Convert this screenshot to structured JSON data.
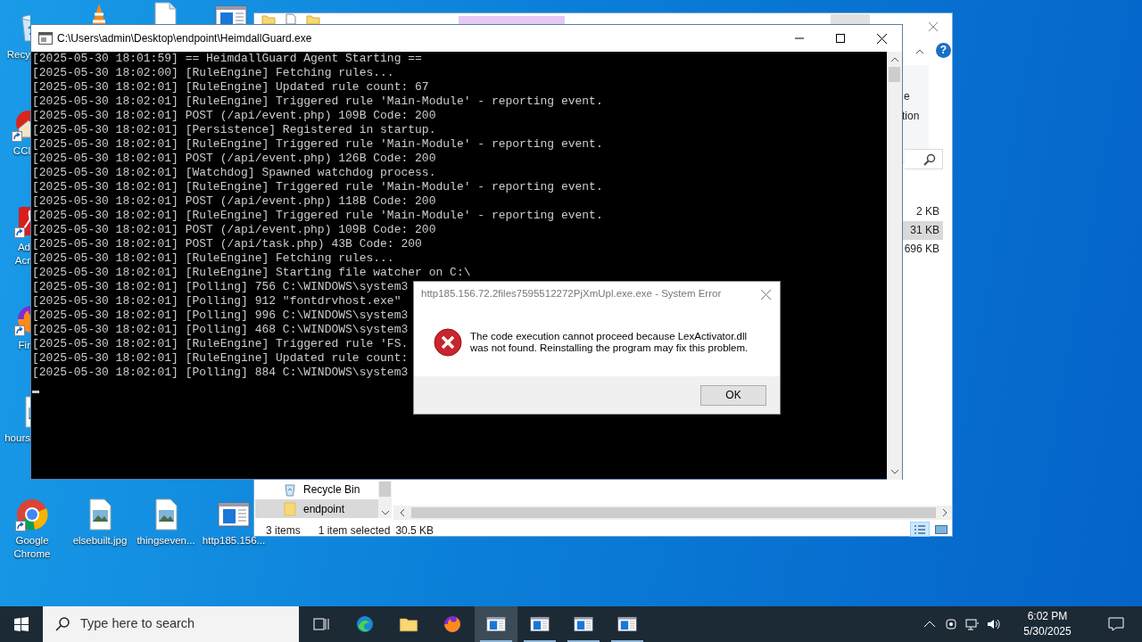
{
  "desktop_icons": [
    {
      "kind": "bin",
      "lines": [
        "Recy"
      ],
      "shortcut": false
    },
    {
      "kind": "cone"
    },
    {
      "kind": "doc"
    },
    {
      "kind": "window"
    },
    {
      "kind": "ccleaner",
      "lines": [
        "CCl"
      ],
      "shortcut": true
    },
    {
      "kind": "acrobat",
      "lines": [
        "Ad",
        "Acr"
      ],
      "shortcut": true
    },
    {
      "kind": "firefox",
      "lines": [
        "Fir"
      ],
      "shortcut": true
    },
    {
      "kind": "image",
      "lines": [
        "hours"
      ],
      "shortcut": false
    },
    {
      "kind": "chrome",
      "lines": [
        "Google",
        "Chrome"
      ],
      "shortcut": true
    },
    {
      "kind": "image",
      "lines": [
        "elsebuilt.jpg"
      ],
      "shortcut": false
    },
    {
      "kind": "image",
      "lines": [
        "thingseven..."
      ],
      "shortcut": false
    },
    {
      "kind": "window",
      "lines": [
        "http185.156..."
      ],
      "shortcut": false
    }
  ],
  "explorer": {
    "ribbon_texts": [
      "e",
      "tion"
    ],
    "help_glyph": "?",
    "sizes": [
      {
        "text": "2 KB",
        "selected": false
      },
      {
        "text": "31 KB",
        "selected": true
      },
      {
        "text": "696 KB",
        "selected": false
      }
    ],
    "nav_items": [
      {
        "label": "Recycle Bin",
        "kind": "bin",
        "selected": false
      },
      {
        "label": "endpoint",
        "kind": "folder",
        "selected": true
      }
    ],
    "status": {
      "count": "3 items",
      "selection": "1 item selected",
      "size": "30.5 KB"
    },
    "views": [
      {
        "kind": "details",
        "selected": true
      },
      {
        "kind": "thumbnails",
        "selected": false
      }
    ]
  },
  "console": {
    "title": "C:\\Users\\admin\\Desktop\\endpoint\\HeimdallGuard.exe",
    "lines": [
      "[2025-05-30 18:01:59] == HeimdallGuard Agent Starting ==",
      "[2025-05-30 18:02:00] [RuleEngine] Fetching rules...",
      "[2025-05-30 18:02:01] [RuleEngine] Updated rule count: 67",
      "[2025-05-30 18:02:01] [RuleEngine] Triggered rule 'Main-Module' - reporting event.",
      "[2025-05-30 18:02:01] POST (/api/event.php) 109B Code: 200",
      "[2025-05-30 18:02:01] [Persistence] Registered in startup.",
      "[2025-05-30 18:02:01] [RuleEngine] Triggered rule 'Main-Module' - reporting event.",
      "[2025-05-30 18:02:01] POST (/api/event.php) 126B Code: 200",
      "[2025-05-30 18:02:01] [Watchdog] Spawned watchdog process.",
      "[2025-05-30 18:02:01] [RuleEngine] Triggered rule 'Main-Module' - reporting event.",
      "[2025-05-30 18:02:01] POST (/api/event.php) 118B Code: 200",
      "[2025-05-30 18:02:01] [RuleEngine] Triggered rule 'Main-Module' - reporting event.",
      "[2025-05-30 18:02:01] POST (/api/event.php) 109B Code: 200",
      "[2025-05-30 18:02:01] POST (/api/task.php) 43B Code: 200",
      "[2025-05-30 18:02:01] [RuleEngine] Fetching rules...",
      "[2025-05-30 18:02:01] [RuleEngine] Starting file watcher on C:\\",
      "[2025-05-30 18:02:01] [Polling] 756 C:\\WINDOWS\\system3",
      "[2025-05-30 18:02:01] [Polling] 912 \"fontdrvhost.exe\"",
      "[2025-05-30 18:02:01] [Polling] 996 C:\\WINDOWS\\system3",
      "[2025-05-30 18:02:01] [Polling] 468 C:\\WINDOWS\\system3",
      "[2025-05-30 18:02:01] [RuleEngine] Triggered rule 'FS.",
      "[2025-05-30 18:02:01] [RuleEngine] Updated rule count:",
      "[2025-05-30 18:02:01] [Polling] 884 C:\\WINDOWS\\system3"
    ]
  },
  "dialog": {
    "title": "http185.156.72.2files7595512272PjXmUpl.exe.exe - System Error",
    "message_lines": [
      "The code execution cannot proceed because LexActivator.dll",
      "was not found. Reinstalling the program may fix this problem."
    ],
    "button": "OK"
  },
  "taskbar": {
    "search_placeholder": "Type here to search",
    "apps": [
      {
        "kind": "edge",
        "selected": false,
        "running": false
      },
      {
        "kind": "folder",
        "selected": false,
        "running": false
      },
      {
        "kind": "firefox",
        "selected": false,
        "running": false
      },
      {
        "kind": "window",
        "selected": true,
        "running": true
      },
      {
        "kind": "window",
        "selected": false,
        "running": true
      },
      {
        "kind": "window",
        "selected": false,
        "running": true
      },
      {
        "kind": "window",
        "selected": false,
        "running": true
      }
    ],
    "time": "6:02 PM",
    "date": "5/30/2025"
  }
}
